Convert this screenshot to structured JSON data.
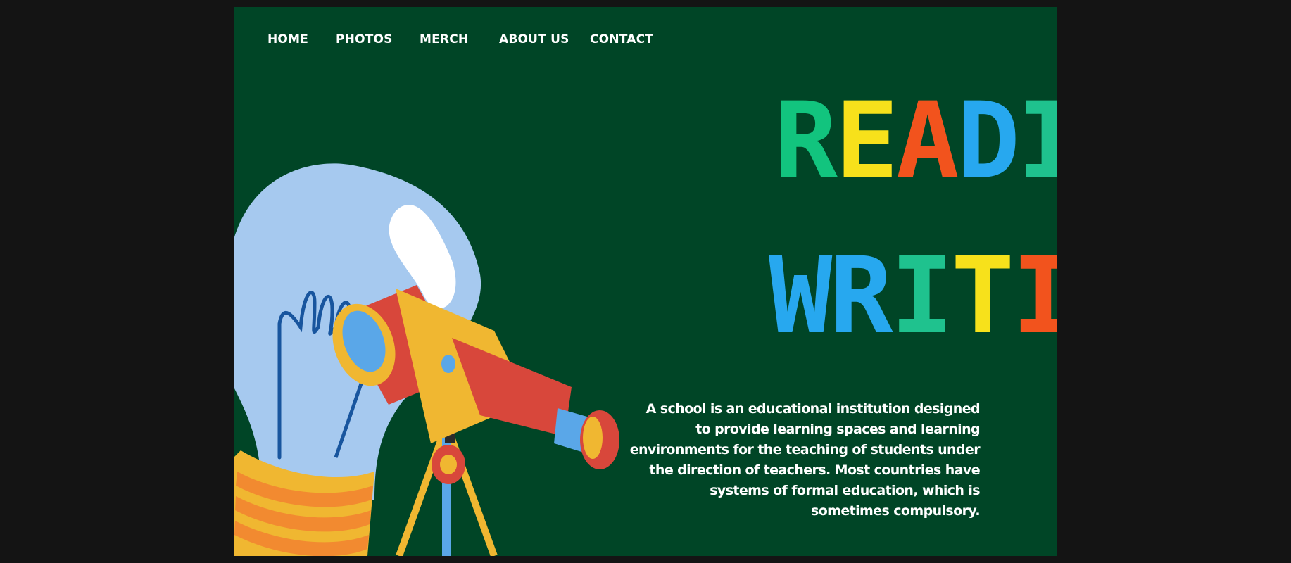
{
  "nav": {
    "items": [
      {
        "label": "HOME"
      },
      {
        "label": "PHOTOS"
      },
      {
        "label": "MERCH"
      },
      {
        "label": "ABOUT US"
      },
      {
        "label": "CONTACT"
      }
    ]
  },
  "hero": {
    "title_line1": "READING",
    "title_line2": "WRITING",
    "description": "A school is an educational institution designed to provide learning spaces and learning environments for the teaching of students under the direction of teachers. Most countries have systems of formal education, which is sometimes compulsory."
  },
  "colors": {
    "page_bg": "#004526",
    "outer_bg": "#141414",
    "green": "#12c47e",
    "yellow": "#f7e11b",
    "orange": "#f2531d",
    "blue": "#27a8ef",
    "teal": "#1fc28e"
  },
  "illustration": {
    "icons": [
      "lightbulb-icon",
      "telescope-icon",
      "tripod-icon"
    ]
  }
}
